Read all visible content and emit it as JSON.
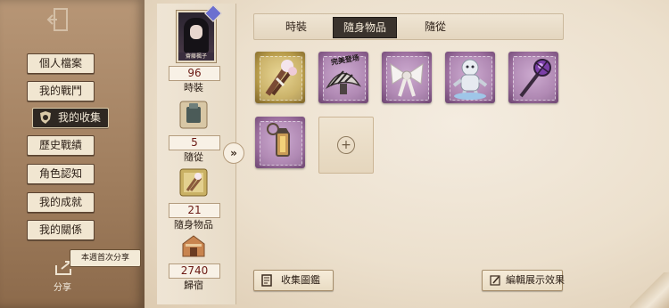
{
  "nav": {
    "items": [
      {
        "label": "個人檔案"
      },
      {
        "label": "我的戰鬥"
      },
      {
        "label": "我的收集",
        "active": true
      },
      {
        "label": "歷史戰績"
      },
      {
        "label": "角色認知"
      },
      {
        "label": "我的成就"
      },
      {
        "label": "我的關係"
      }
    ],
    "share_badge": "本週首次分享",
    "share_label": "分享"
  },
  "profile": {
    "character_name": "齋藤楓子",
    "stats": [
      {
        "count": "96",
        "label": "時裝"
      },
      {
        "count": "5",
        "label": "隨從"
      },
      {
        "count": "21",
        "label": "隨身物品"
      },
      {
        "count": "2740",
        "label": "歸宿"
      }
    ],
    "expand_symbol": "»"
  },
  "tabs": [
    {
      "label": "時裝"
    },
    {
      "label": "隨身物品",
      "selected": true
    },
    {
      "label": "隨從"
    }
  ],
  "items": [
    {
      "name": "bouquet-item",
      "frame": "gold"
    },
    {
      "name": "feather-fan-item",
      "frame": "purple",
      "caption": "完美登场"
    },
    {
      "name": "white-bow-item",
      "frame": "purple"
    },
    {
      "name": "rag-doll-item",
      "frame": "purple"
    },
    {
      "name": "gem-scepter-item",
      "frame": "purple"
    },
    {
      "name": "lantern-item",
      "frame": "purple"
    }
  ],
  "empty_slot_symbol": "+",
  "buttons": {
    "collection_catalog": "收集圖鑑",
    "edit_display": "編輯展示效果"
  },
  "colors": {
    "nav_active_bg": "#2f2822",
    "count_text": "#6b1a14",
    "gold_frame": "#b79b4a",
    "purple_frame": "#9c6f9e"
  }
}
